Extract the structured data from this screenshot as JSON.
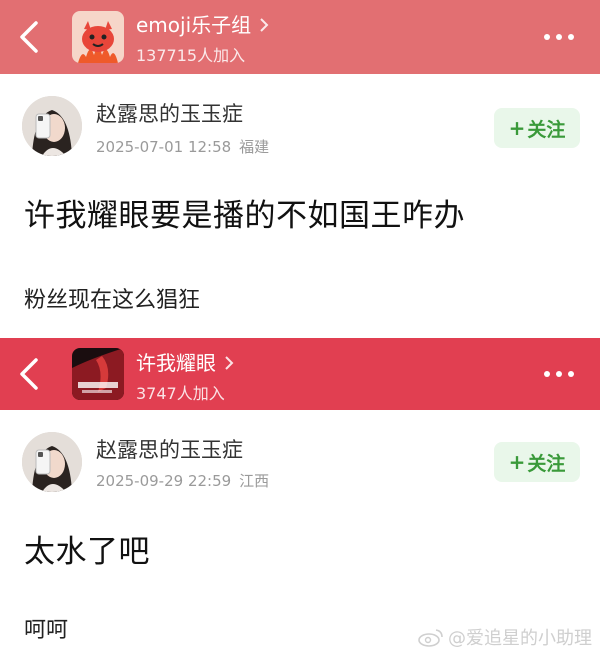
{
  "colors": {
    "header1_bg": "#e26f72",
    "header2_bg": "#e13f51",
    "follow_bg": "#e9f7ea",
    "follow_text": "#3a9a3a"
  },
  "screens": [
    {
      "group": {
        "name": "emoji乐子组",
        "members": "137715人加入",
        "avatar_icon": "fire-creature-icon"
      },
      "post": {
        "author": "赵露思的玉玉症",
        "date": "2025-07-01 12:58",
        "location": "福建",
        "follow_label": "关注",
        "title": "许我耀眼要是播的不如国王咋办",
        "body": "粉丝现在这么猖狂"
      }
    },
    {
      "group": {
        "name": "许我耀眼",
        "members": "3747人加入",
        "avatar_icon": "drama-poster-icon"
      },
      "post": {
        "author": "赵露思的玉玉症",
        "date": "2025-09-29 22:59",
        "location": "江西",
        "follow_label": "关注",
        "title": "太水了吧",
        "body": "呵呵"
      }
    }
  ],
  "watermark": "@爱追星的小助理"
}
